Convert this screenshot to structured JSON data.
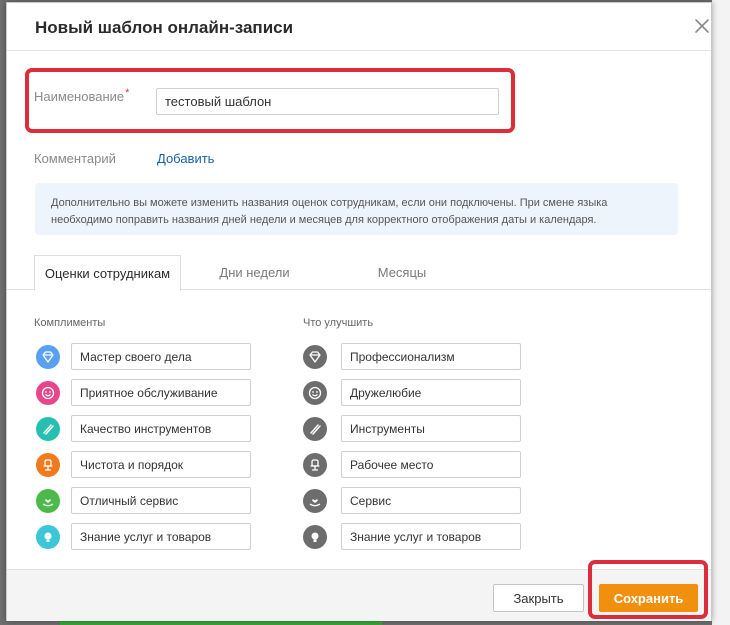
{
  "modal": {
    "title": "Новый шаблон онлайн-записи",
    "close_icon": "close-icon"
  },
  "form": {
    "name_label": "Наименование",
    "required_mark": "*",
    "name_value": "тестовый шаблон",
    "comment_label": "Комментарий",
    "add_link": "Добавить"
  },
  "info_text": "Дополнительно вы можете изменить названия оценок сотрудникам, если они подключены. При смене языка необходимо поправить названия дней недели и месяцев для корректного отображения даты и календаря.",
  "tabs": [
    {
      "label": "Оценки сотрудникам",
      "active": true
    },
    {
      "label": "Дни недели",
      "active": false
    },
    {
      "label": "Месяцы",
      "active": false
    }
  ],
  "compliments": {
    "title": "Комплименты",
    "items": [
      {
        "value": "Мастер своего дела",
        "icon": "diamond-icon",
        "color": "#5aa0f0"
      },
      {
        "value": "Приятное обслуживание",
        "icon": "smile-icon",
        "color": "#e8468a"
      },
      {
        "value": "Качество инструментов",
        "icon": "tools-icon",
        "color": "#27c0b0"
      },
      {
        "value": "Чистота и порядок",
        "icon": "chair-icon",
        "color": "#f07a1e"
      },
      {
        "value": "Отличный сервис",
        "icon": "hand-heart-icon",
        "color": "#4cba4a"
      },
      {
        "value": "Знание услуг и товаров",
        "icon": "lightbulb-icon",
        "color": "#3cc7d8"
      }
    ]
  },
  "improve": {
    "title": "Что улучшить",
    "items": [
      {
        "value": "Профессионализм",
        "icon": "diamond-icon"
      },
      {
        "value": "Дружелюбие",
        "icon": "smile-icon"
      },
      {
        "value": "Инструменты",
        "icon": "tools-icon"
      },
      {
        "value": "Рабочее место",
        "icon": "chair-icon"
      },
      {
        "value": "Сервис",
        "icon": "hand-heart-icon"
      },
      {
        "value": "Знание услуг и товаров",
        "icon": "lightbulb-icon"
      }
    ]
  },
  "footer": {
    "close_label": "Закрыть",
    "save_label": "Сохранить"
  },
  "colors": {
    "accent": "#f0900e",
    "highlight": "#dd2c3a",
    "link": "#1a5ea8"
  }
}
